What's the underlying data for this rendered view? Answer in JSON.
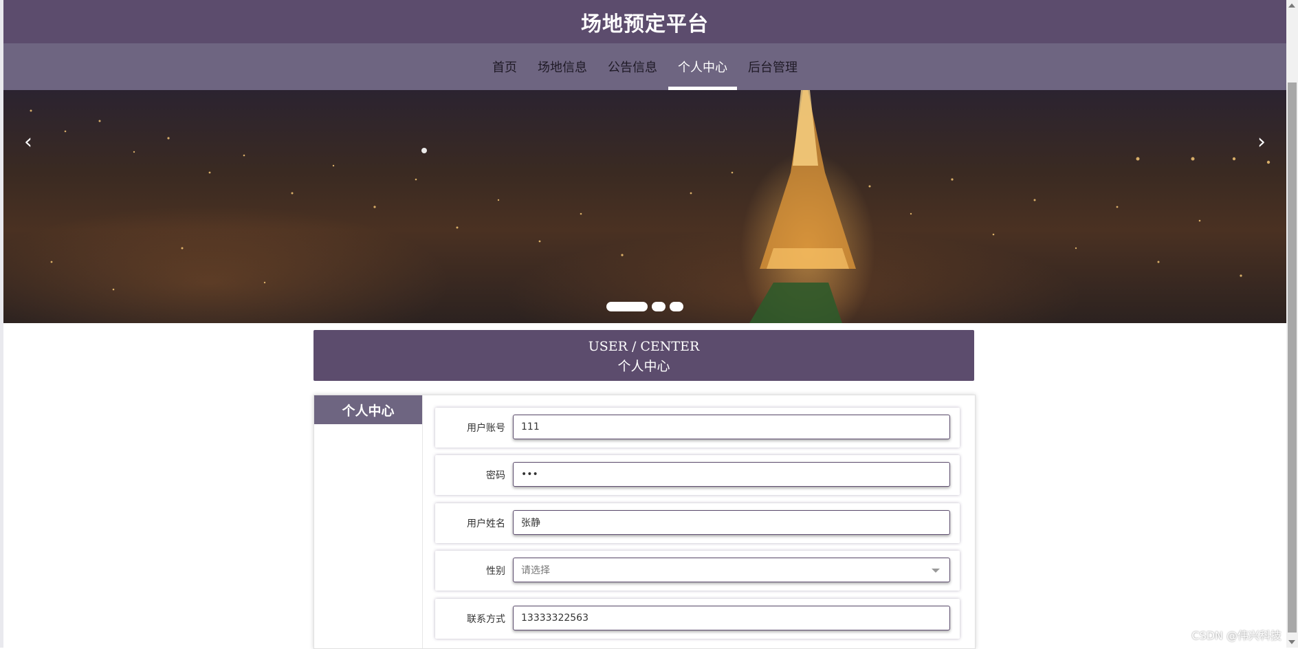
{
  "site": {
    "title": "场地预定平台"
  },
  "nav": {
    "items": [
      {
        "label": "首页",
        "active": false
      },
      {
        "label": "场地信息",
        "active": false
      },
      {
        "label": "公告信息",
        "active": false
      },
      {
        "label": "个人中心",
        "active": true
      },
      {
        "label": "后台管理",
        "active": false
      }
    ]
  },
  "carousel": {
    "prev_icon": "chevron-left-icon",
    "next_icon": "chevron-right-icon",
    "slide_count": 3,
    "active_slide": 1
  },
  "section": {
    "title_en": "USER / CENTER",
    "title_cn": "个人中心"
  },
  "sidebar": {
    "title": "个人中心"
  },
  "form": {
    "account": {
      "label": "用户账号",
      "value": "111"
    },
    "password": {
      "label": "密码",
      "value": "•••"
    },
    "name": {
      "label": "用户姓名",
      "value": "张静"
    },
    "gender": {
      "label": "性别",
      "placeholder": "请选择"
    },
    "phone": {
      "label": "联系方式",
      "value": "13333322563"
    }
  },
  "watermark": "CSDN @伟兴科技",
  "colors": {
    "primary": "#5c4c6d",
    "nav_bg": "#6e6581",
    "nav_text": "#1f1a26"
  }
}
